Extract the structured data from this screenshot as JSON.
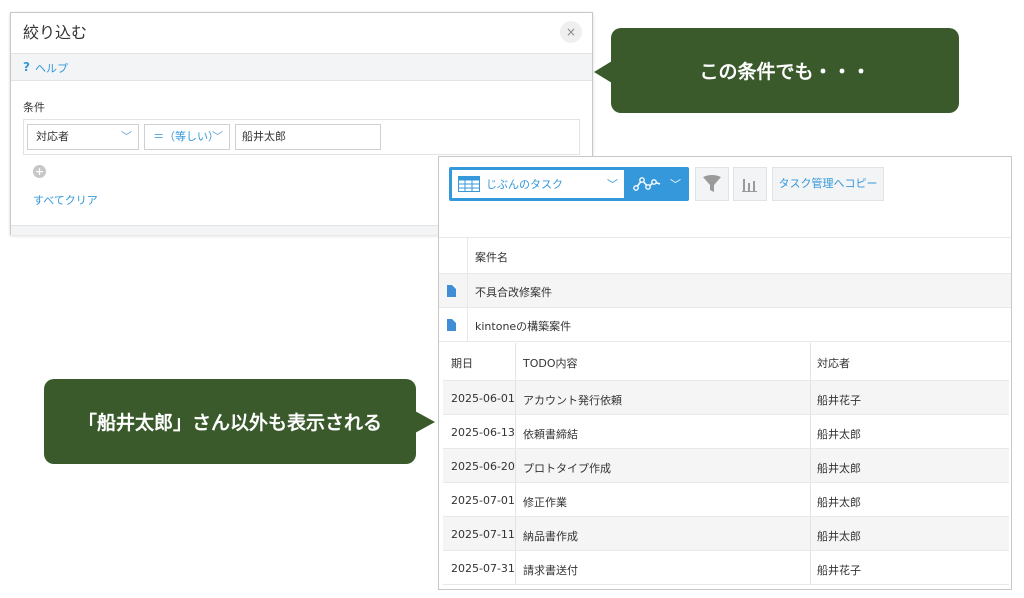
{
  "filter_dialog": {
    "title": "絞り込む",
    "close_glyph": "×",
    "help_mark": "?",
    "help_label": "ヘルプ",
    "condition_label": "条件",
    "field_select": "対応者",
    "operator_select": "＝（等しい）",
    "value": "船井太郎",
    "add_glyph": "+",
    "clear_all": "すべてクリア"
  },
  "callouts": {
    "top": "この条件でも・・・",
    "bottom": "「船井太郎」さん以外も表示される"
  },
  "records_panel": {
    "toolbar": {
      "view_name": "じぶんのタスク",
      "copy_button": "タスク管理へコピー"
    },
    "table_header": "案件名",
    "records": [
      "不具合改修案件",
      "kintoneの構築案件"
    ],
    "subtable": {
      "columns": [
        "期日",
        "TODO内容",
        "対応者"
      ],
      "rows": [
        [
          "2025-06-01",
          "アカウント発行依頼",
          "船井花子"
        ],
        [
          "2025-06-13",
          "依頼書締結",
          "船井太郎"
        ],
        [
          "2025-06-20",
          "プロトタイプ作成",
          "船井太郎"
        ],
        [
          "2025-07-01",
          "修正作業",
          "船井太郎"
        ],
        [
          "2025-07-11",
          "納品書作成",
          "船井太郎"
        ],
        [
          "2025-07-31",
          "請求書送付",
          "船井花子"
        ]
      ]
    }
  },
  "colors": {
    "accent": "#3498db",
    "callout": "#3a5a2c"
  }
}
